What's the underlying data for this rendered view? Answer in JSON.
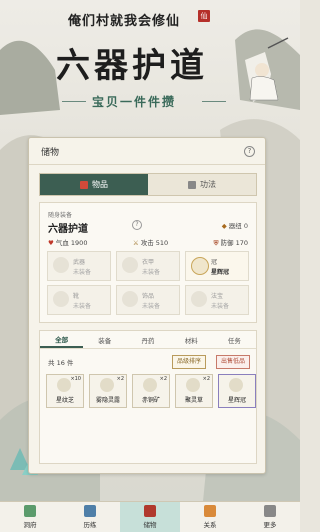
{
  "header": {
    "game_title": "俺们村就我会修仙",
    "seal": "仙",
    "headline": "六器护道",
    "subtitle": "宝贝一件件攒"
  },
  "panel": {
    "title": "储物",
    "tabs": [
      {
        "label": "物品",
        "active": true
      },
      {
        "label": "功法",
        "active": false
      }
    ],
    "equipment": {
      "section_label": "随身装备",
      "name": "六器护道",
      "level_label": "器纽",
      "level_value": "0",
      "stats": [
        {
          "icon": "heart-icon",
          "label": "气血",
          "value": "1900"
        },
        {
          "icon": "swords-icon",
          "label": "攻击",
          "value": "510"
        },
        {
          "icon": "shield-icon",
          "label": "防御",
          "value": "170"
        }
      ],
      "slots": [
        {
          "name": "武器",
          "state": "未装备",
          "equipped": false
        },
        {
          "name": "衣甲",
          "state": "未装备",
          "equipped": false
        },
        {
          "name": "冠",
          "state": "星辉冠",
          "equipped": true
        },
        {
          "name": "靴",
          "state": "未装备",
          "equipped": false
        },
        {
          "name": "饰品",
          "state": "未装备",
          "equipped": false
        },
        {
          "name": "法宝",
          "state": "未装备",
          "equipped": false
        }
      ]
    },
    "inventory": {
      "tabs": [
        "全部",
        "装备",
        "丹药",
        "材料",
        "任务"
      ],
      "active_tab": "全部",
      "count_text": "共 16 件",
      "sort_button": "品级排序",
      "sell_button": "出售低品",
      "items": [
        {
          "name": "星纹芝",
          "count": "×10",
          "rare": false
        },
        {
          "name": "雾隐灵露",
          "count": "×2",
          "rare": false
        },
        {
          "name": "赤铜矿",
          "count": "×2",
          "rare": false
        },
        {
          "name": "聚灵草",
          "count": "×2",
          "rare": false
        },
        {
          "name": "星辉冠",
          "count": "",
          "rare": true
        }
      ]
    }
  },
  "bottom_nav": [
    {
      "label": "洞府",
      "icon": "mountain-icon",
      "color": "#5b9b6c",
      "active": false
    },
    {
      "label": "历练",
      "icon": "sword-icon",
      "color": "#4f7fa8",
      "active": false
    },
    {
      "label": "储物",
      "icon": "bag-icon",
      "color": "#b03a2e",
      "active": true
    },
    {
      "label": "关系",
      "icon": "people-icon",
      "color": "#d98a3a",
      "active": false
    },
    {
      "label": "更多",
      "icon": "more-icon",
      "color": "#888888",
      "active": false
    }
  ],
  "colors": {
    "accent": "#3c5e52",
    "equipped_border": "#c9a65a",
    "sell": "#b04e3a",
    "sort": "#8a6a2a"
  }
}
